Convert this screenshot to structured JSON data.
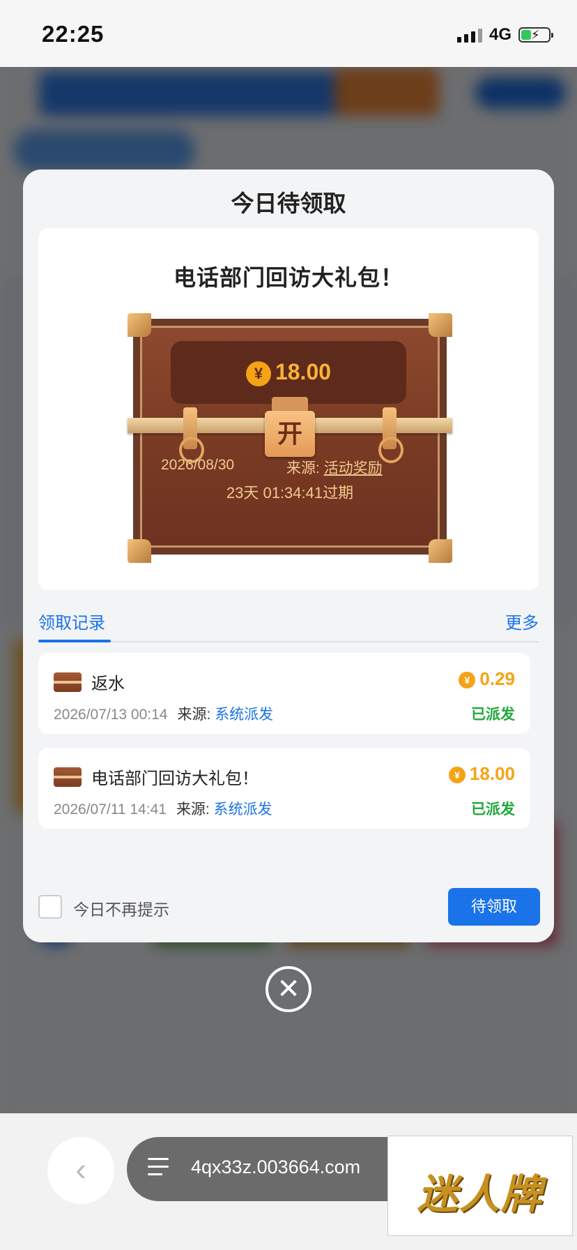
{
  "status_bar": {
    "time": "22:25",
    "network": "4G"
  },
  "modal": {
    "title": "今日待领取",
    "gift": {
      "title": "电话部门回访大礼包！",
      "amount": "18.00",
      "lock_label": "开",
      "date": "2026/08/30",
      "source_label": "来源:",
      "source_value": "活动奖励",
      "expiry": "23天 01:34:41过期"
    },
    "tabs": {
      "active": "领取记录",
      "more": "更多"
    },
    "records": [
      {
        "name": "返水",
        "amount": "0.29",
        "datetime": "2026/07/13 00:14",
        "source_label": "来源:",
        "source_value": "系统派发",
        "status": "已派发"
      },
      {
        "name": "电话部门回访大礼包！",
        "amount": "18.00",
        "datetime": "2026/07/11 14:41",
        "source_label": "来源:",
        "source_value": "系统派发",
        "status": "已派发"
      }
    ],
    "dont_remind_label": "今日不再提示",
    "claim_button": "待领取"
  },
  "browser": {
    "url": "4qx33z.003664.com",
    "back_icon": "chevron-left-icon"
  },
  "ad": {
    "text": "迷人牌"
  },
  "colors": {
    "accent": "#1a73e8",
    "gold": "#f5a316",
    "success": "#1fa83b"
  }
}
